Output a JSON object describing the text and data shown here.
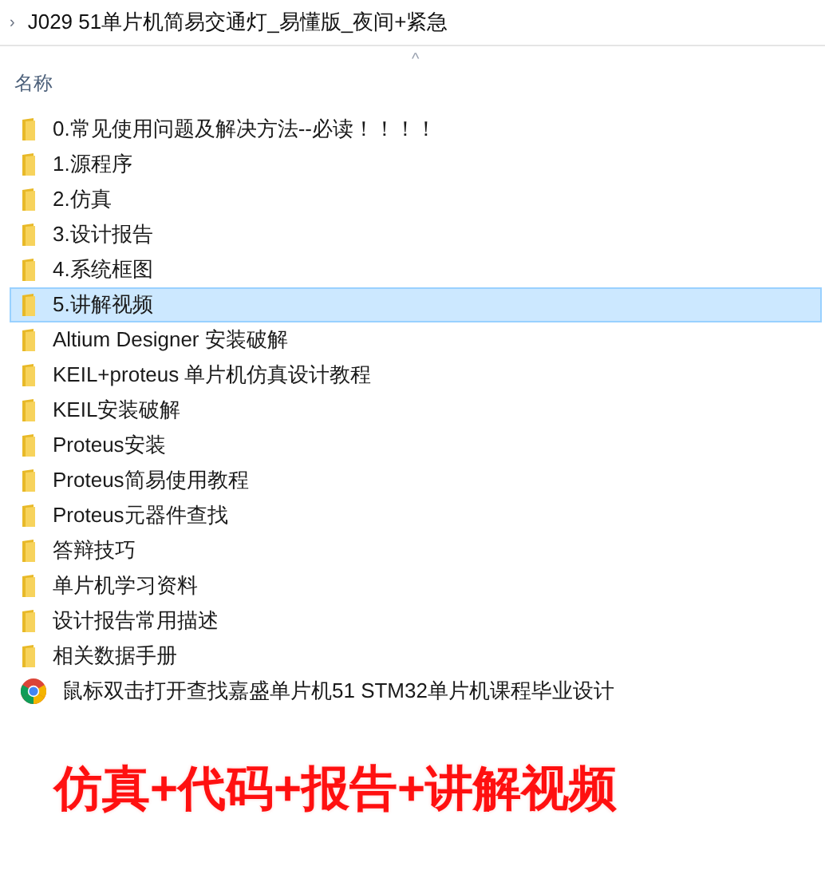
{
  "breadcrumb": {
    "separator": "›",
    "path": "J029 51单片机简易交通灯_易懂版_夜间+紧急"
  },
  "column_header": {
    "label": "名称",
    "sort_indicator": "^"
  },
  "files": [
    {
      "kind": "folder",
      "name": "0.常见使用问题及解决方法--必读！！！！",
      "selected": false
    },
    {
      "kind": "folder",
      "name": "1.源程序",
      "selected": false
    },
    {
      "kind": "folder",
      "name": "2.仿真",
      "selected": false
    },
    {
      "kind": "folder",
      "name": "3.设计报告",
      "selected": false
    },
    {
      "kind": "folder",
      "name": "4.系统框图",
      "selected": false
    },
    {
      "kind": "folder",
      "name": "5.讲解视频",
      "selected": true
    },
    {
      "kind": "folder",
      "name": "Altium Designer 安装破解",
      "selected": false
    },
    {
      "kind": "folder",
      "name": "KEIL+proteus 单片机仿真设计教程",
      "selected": false
    },
    {
      "kind": "folder",
      "name": "KEIL安装破解",
      "selected": false
    },
    {
      "kind": "folder",
      "name": "Proteus安装",
      "selected": false
    },
    {
      "kind": "folder",
      "name": "Proteus简易使用教程",
      "selected": false
    },
    {
      "kind": "folder",
      "name": "Proteus元器件查找",
      "selected": false
    },
    {
      "kind": "folder",
      "name": "答辩技巧",
      "selected": false
    },
    {
      "kind": "folder",
      "name": "单片机学习资料",
      "selected": false
    },
    {
      "kind": "folder",
      "name": "设计报告常用描述",
      "selected": false
    },
    {
      "kind": "folder",
      "name": "相关数据手册",
      "selected": false
    },
    {
      "kind": "link",
      "name": "鼠标双击打开查找嘉盛单片机51 STM32单片机课程毕业设计",
      "selected": false
    }
  ],
  "caption": "仿真+代码+报告+讲解视频"
}
